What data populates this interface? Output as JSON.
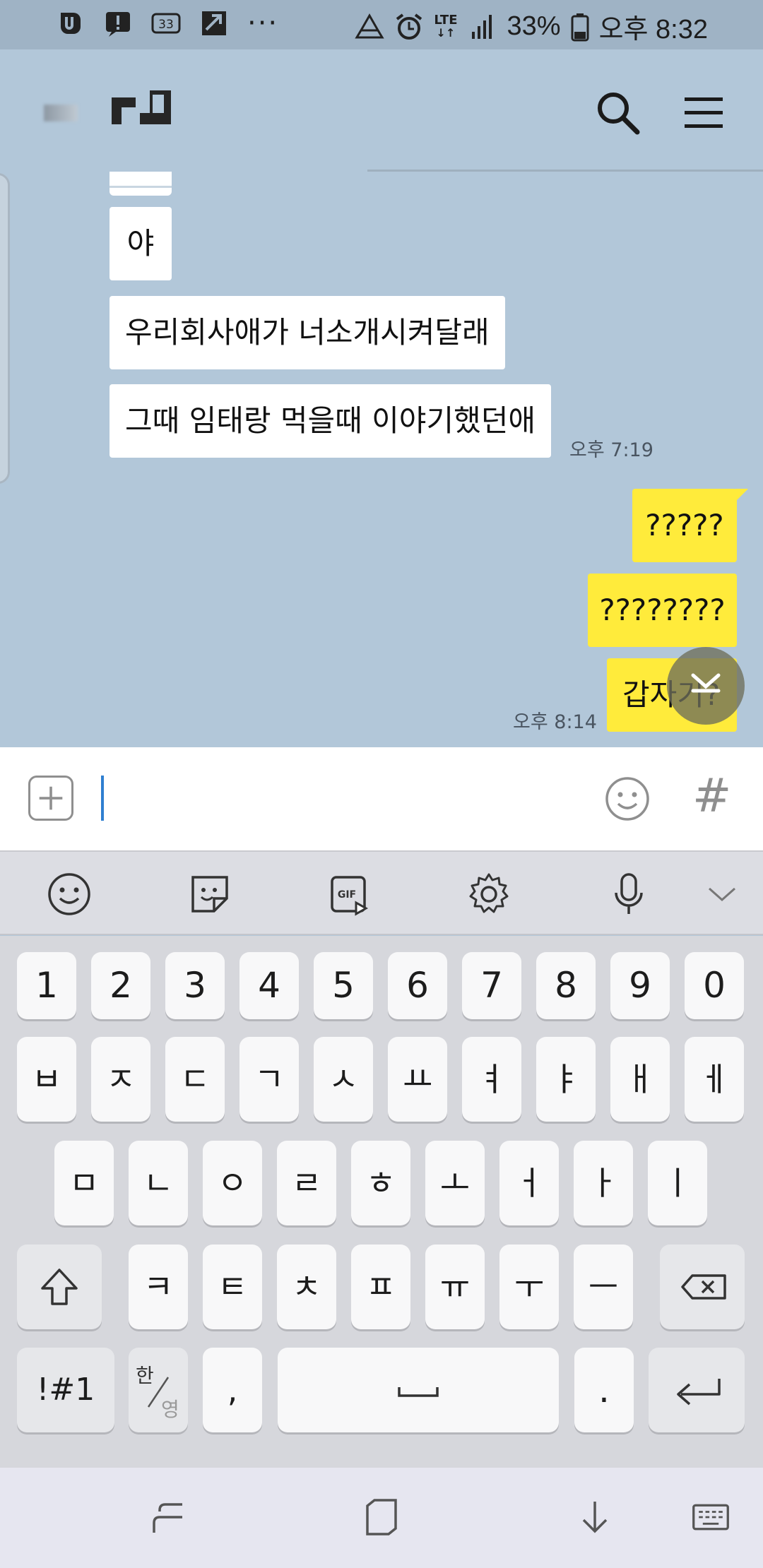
{
  "status_bar": {
    "battery": "33%",
    "time": "오후 8:32",
    "network": "LTE",
    "notification_badge": "33",
    "icons": [
      "u-plus-icon",
      "alert-message-icon",
      "badge-33-icon",
      "screenshot-icon",
      "more-dots-icon",
      "recycle-icon",
      "alarm-icon",
      "lte-icon",
      "signal-icon",
      "battery-icon"
    ]
  },
  "header": {
    "icons": [
      "back-icon",
      "search-icon",
      "menu-icon"
    ]
  },
  "messages": [
    {
      "side": "received",
      "text": "야"
    },
    {
      "side": "received",
      "text": "우리회사애가 너소개시켜달래"
    },
    {
      "side": "received",
      "text": "그때 임태랑 먹을때 이야기했던애",
      "time": "오후 7:19"
    },
    {
      "side": "sent",
      "text": "?????"
    },
    {
      "side": "sent",
      "text": "????????"
    },
    {
      "side": "sent",
      "text": "갑자기?",
      "time": "오후 8:14"
    }
  ],
  "input": {
    "value": "",
    "hash_label": "#"
  },
  "keyboard": {
    "toolbar": [
      "emoji-icon",
      "sticker-icon",
      "gif-icon",
      "settings-icon",
      "microphone-icon",
      "chevron-down-icon"
    ],
    "gif_label": "GIF",
    "row_numbers": [
      "1",
      "2",
      "3",
      "4",
      "5",
      "6",
      "7",
      "8",
      "9",
      "0"
    ],
    "row1": [
      "ㅂ",
      "ㅈ",
      "ㄷ",
      "ㄱ",
      "ㅅ",
      "ㅛ",
      "ㅕ",
      "ㅑ",
      "ㅐ",
      "ㅔ"
    ],
    "row2": [
      "ㅁ",
      "ㄴ",
      "ㅇ",
      "ㄹ",
      "ㅎ",
      "ㅗ",
      "ㅓ",
      "ㅏ",
      "ㅣ"
    ],
    "row3": [
      "ㅋ",
      "ㅌ",
      "ㅊ",
      "ㅍ",
      "ㅠ",
      "ㅜ",
      "ㅡ"
    ],
    "symbols_label": "!#1",
    "lang_top": "한",
    "lang_bottom": "영",
    "comma": ",",
    "period": "."
  },
  "nav_bar": {
    "icons": [
      "back-gesture-icon",
      "recents-icon",
      "hide-keyboard-icon",
      "keyboard-switch-icon"
    ]
  },
  "colors": {
    "chat_background": "#b2c7d9",
    "sent_bubble": "#ffeb3b",
    "received_bubble": "#ffffff",
    "keyboard_background": "#d6d7dc"
  }
}
